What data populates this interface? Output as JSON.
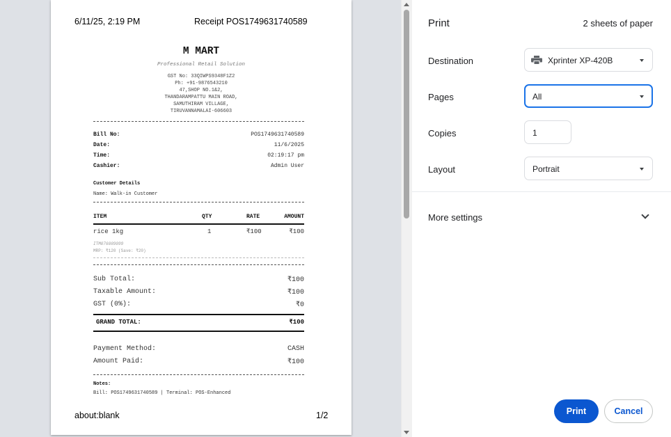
{
  "preview": {
    "header_datetime": "6/11/25, 2:19 PM",
    "header_title": "Receipt POS1749631740589",
    "footer_url": "about:blank",
    "footer_page": "1/2"
  },
  "receipt": {
    "store_name": "M MART",
    "tagline": "Professional Retail Solution",
    "address_lines": [
      "GST No: 33QIWPS9348F1Z2",
      "Ph: +91-9876543210",
      "47,SHOP NO.1&2,",
      "THANDARAMPATTU MAIN ROAD,",
      "SAMUTHIRAM VILLAGE,",
      "TIRUVANNAMALAI-606603"
    ],
    "bill_no_label": "Bill No:",
    "bill_no": "POS1749631740589",
    "date_label": "Date:",
    "date": "11/6/2025",
    "time_label": "Time:",
    "time": "02:19:17 pm",
    "cashier_label": "Cashier:",
    "cashier": "Admin User",
    "customer_heading": "Customer Details",
    "customer_name": "Name: Walk-in Customer",
    "columns": [
      "ITEM",
      "QTY",
      "RATE",
      "AMOUNT"
    ],
    "items": [
      {
        "name": "rice 1kg",
        "qty": "1",
        "rate": "₹100",
        "amount": "₹100",
        "code": "ITM076089099",
        "mrp": "MRP: ₹120 (Save: ₹20)"
      }
    ],
    "subtotal_label": "Sub Total:",
    "subtotal": "₹100",
    "taxable_label": "Taxable Amount:",
    "taxable": "₹100",
    "gst_label": "GST (0%):",
    "gst": "₹0",
    "grand_label": "GRAND TOTAL:",
    "grand": "₹100",
    "payment_label": "Payment Method:",
    "payment": "CASH",
    "paid_label": "Amount Paid:",
    "paid": "₹100",
    "notes_label": "Notes:",
    "notes": "Bill: POS1749631740589 | Terminal: POS-Enhanced"
  },
  "settings": {
    "title": "Print",
    "sheets": "2 sheets of paper",
    "destination_label": "Destination",
    "destination": "Xprinter XP-420B",
    "pages_label": "Pages",
    "pages": "All",
    "copies_label": "Copies",
    "copies": "1",
    "layout_label": "Layout",
    "layout": "Portrait",
    "more_settings": "More settings",
    "print_button": "Print",
    "cancel_button": "Cancel"
  },
  "colors": {
    "accent": "#0b57d0",
    "focus": "#1a73e8",
    "preview_bg": "#dee1e6"
  },
  "icons": [
    "printer-icon",
    "chevron-down-icon",
    "dropdown-arrow-icon"
  ]
}
